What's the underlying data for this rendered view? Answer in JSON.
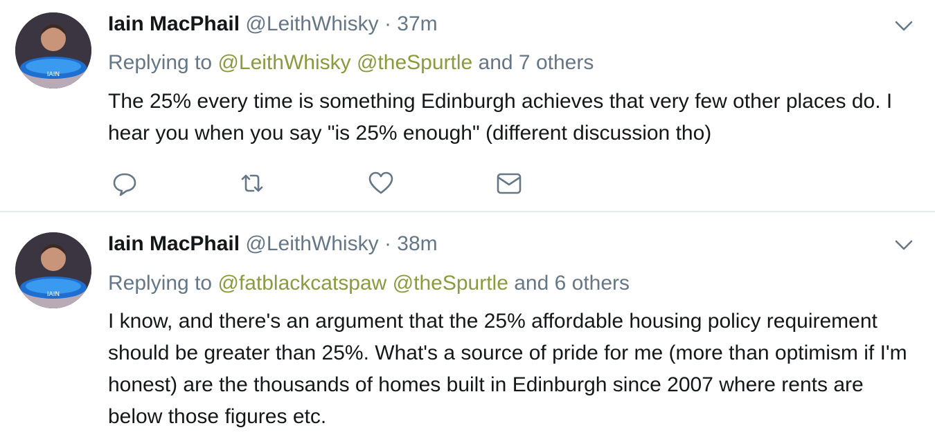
{
  "tweets": [
    {
      "name": "Iain MacPhail",
      "handle": "@LeithWhisky",
      "dot": "·",
      "time": "37m",
      "replying_prefix": "Replying to",
      "mentions": [
        "@LeithWhisky",
        "@theSpurtle"
      ],
      "replying_suffix": "and 7 others",
      "text": "The 25% every time is something Edinburgh achieves that very few other places do. I hear you when you say \"is 25% enough\" (different discussion tho)",
      "avatar_label": "IAIN"
    },
    {
      "name": "Iain MacPhail",
      "handle": "@LeithWhisky",
      "dot": "·",
      "time": "38m",
      "replying_prefix": "Replying to",
      "mentions": [
        "@fatblackcatspaw",
        "@theSpurtle"
      ],
      "replying_suffix": "and 6 others",
      "text": "I know, and there's an argument that the 25% affordable housing policy requirement should be greater than 25%. What's a source of pride for me (more than optimism if I'm honest) are the thousands of homes built in Edinburgh since 2007 where rents are below those figures etc.",
      "avatar_label": "IAIN"
    }
  ],
  "icons": {
    "reply": "reply-icon",
    "retweet": "retweet-icon",
    "like": "heart-icon",
    "dm": "envelope-icon",
    "menu": "chevron-down-icon"
  },
  "colors": {
    "text": "#14171a",
    "secondary": "#657786",
    "mention": "#8a9a3d",
    "divider": "#e6ecf0"
  }
}
